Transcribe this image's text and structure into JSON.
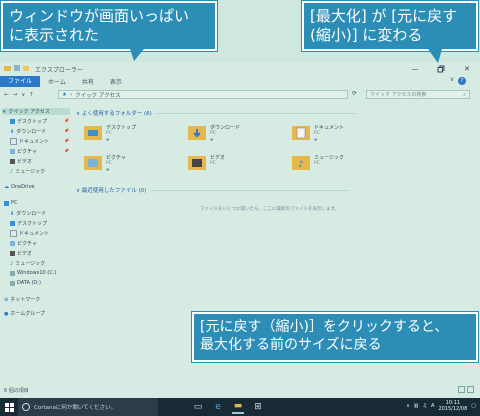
{
  "callouts": {
    "window_maximized": {
      "line1": "ウィンドウが画面いっぱい",
      "line2": "に表示された"
    },
    "button_changed": {
      "line1": "[最大化] が [元に戻す",
      "line2": "(縮小)] に変わる"
    },
    "restore_hint": {
      "line1": "[元に戻す（縮小)］をクリックすると、",
      "line2": "最大化する前のサイズに戻る"
    }
  },
  "window": {
    "title": "エクスプローラー",
    "ribbon_tabs": [
      "ファイル",
      "ホーム",
      "共有",
      "表示"
    ],
    "path": [
      "クイック アクセス"
    ],
    "search_placeholder": "クイック アクセスの検索"
  },
  "sidebar": {
    "quick_access": "クイック アクセス",
    "pinned": [
      "デスクトップ",
      "ダウンロード",
      "ドキュメント",
      "ピクチャ"
    ],
    "others": [
      "ビデオ",
      "ミュージック"
    ],
    "onedrive": "OneDrive",
    "pc": "PC",
    "pc_items": [
      "ダウンロード",
      "デスクトップ",
      "ドキュメント",
      "ピクチャ",
      "ビデオ",
      "ミュージック",
      "Windows10 (C:)",
      "DATA (D:)"
    ],
    "network": "ネットワーク",
    "homegroup": "ホームグループ"
  },
  "content": {
    "frequent_header": "よく使用するフォルダー (6)",
    "folders": [
      {
        "name": "デスクトップ",
        "sub": "PC"
      },
      {
        "name": "ダウンロード",
        "sub": "PC"
      },
      {
        "name": "ドキュメント",
        "sub": "PC"
      },
      {
        "name": "ピクチャ",
        "sub": "PC"
      },
      {
        "name": "ビデオ",
        "sub": "PC"
      },
      {
        "name": "ミュージック",
        "sub": "PC"
      }
    ],
    "recent_header": "最近使用したファイル (0)",
    "empty_message": "ファイルをいくつか開いたら、ここに最新のファイルを表示します。"
  },
  "status": {
    "items": "6 個の項目"
  },
  "taskbar": {
    "cortana": "Cortanaに何か聞いてください。",
    "time": "10:11",
    "date": "2015/12/08",
    "ime": "A"
  },
  "colors": {
    "callout": "#2c8eb6",
    "taskbar": "#172a35",
    "file_tab": "#2b79c8"
  }
}
